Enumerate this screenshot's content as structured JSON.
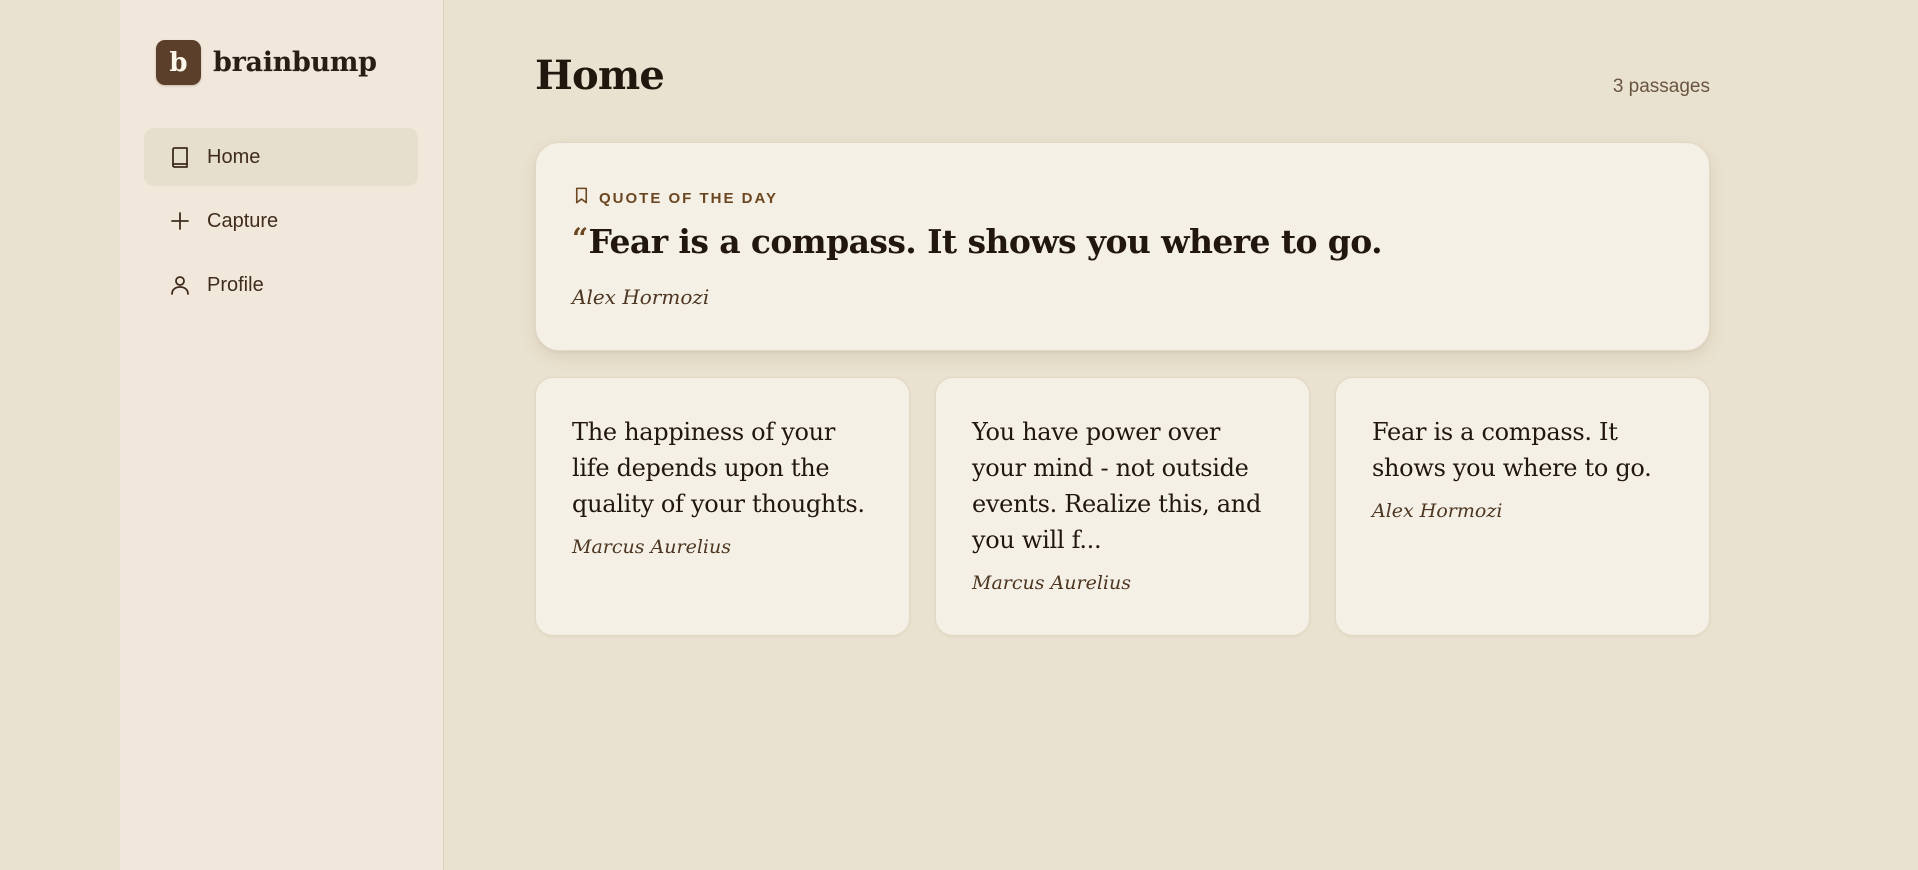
{
  "brand": {
    "mark": "b",
    "name": "brainbump"
  },
  "nav": [
    {
      "label": "Home",
      "icon": "book-icon",
      "active": true
    },
    {
      "label": "Capture",
      "icon": "plus-icon",
      "active": false
    },
    {
      "label": "Profile",
      "icon": "user-icon",
      "active": false
    }
  ],
  "header": {
    "title": "Home",
    "count": "3 passages"
  },
  "quote_of_day": {
    "label": "QUOTE OF THE DAY",
    "icon": "bookmark-icon",
    "open_mark": "“",
    "text": "Fear is a compass. It shows you where to go.",
    "author": "Alex Hormozi"
  },
  "passages": [
    {
      "text": "The happiness of your life depends upon the quality of your thoughts.",
      "author": "Marcus Aurelius"
    },
    {
      "text": "You have power over your mind - not outside events. Realize this, and you will f...",
      "author": "Marcus Aurelius"
    },
    {
      "text": "Fear is a compass. It shows you where to go.",
      "author": "Alex Hormozi"
    }
  ],
  "colors": {
    "background": "#eae2d0",
    "sidebar": "#f1e8db",
    "card": "#f5f0e5",
    "brand_mark": "#5b3f2a",
    "accent": "#6b4620",
    "text": "#22170e"
  }
}
